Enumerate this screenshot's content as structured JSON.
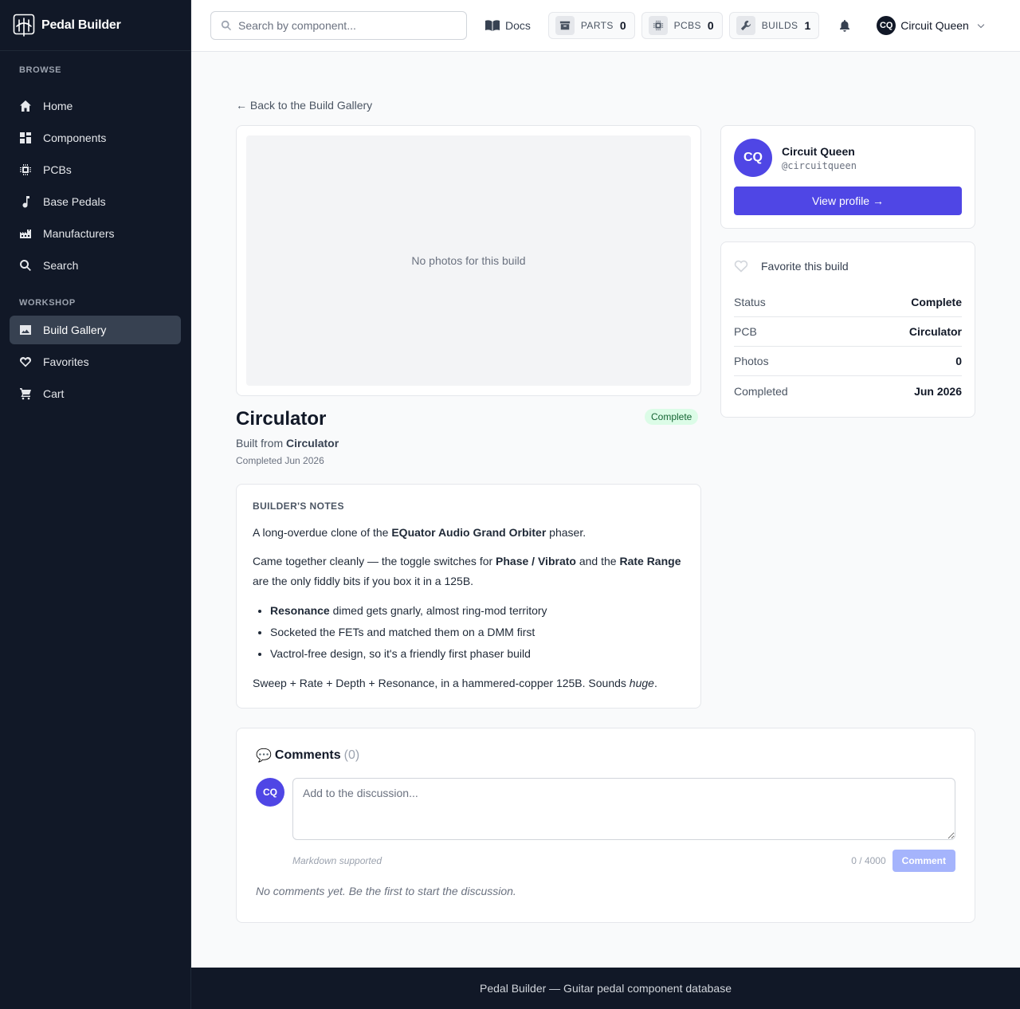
{
  "app": {
    "name": "Pedal Builder"
  },
  "sidebar": {
    "browse_heading": "BROWSE",
    "browse": [
      {
        "label": "Home",
        "icon": "home-icon"
      },
      {
        "label": "Components",
        "icon": "grid-icon"
      },
      {
        "label": "PCBs",
        "icon": "chip-icon"
      },
      {
        "label": "Base Pedals",
        "icon": "music-note-icon"
      },
      {
        "label": "Manufacturers",
        "icon": "factory-icon"
      },
      {
        "label": "Search",
        "icon": "search-icon"
      }
    ],
    "workshop_heading": "WORKSHOP",
    "workshop": [
      {
        "label": "Build Gallery",
        "icon": "image-icon",
        "active": true
      },
      {
        "label": "Favorites",
        "icon": "heart-icon"
      },
      {
        "label": "Cart",
        "icon": "cart-icon"
      }
    ]
  },
  "topbar": {
    "search_placeholder": "Search by component...",
    "docs_label": "Docs",
    "counters": [
      {
        "label": "PARTS",
        "value": "0",
        "icon": "archive-icon"
      },
      {
        "label": "PCBS",
        "value": "0",
        "icon": "chip-icon"
      },
      {
        "label": "BUILDS",
        "value": "1",
        "icon": "wrench-icon"
      }
    ],
    "user": {
      "initials": "CQ",
      "name": "Circuit Queen"
    }
  },
  "build": {
    "back_link": "← Back to the Build Gallery",
    "no_photos": "No photos for this build",
    "title": "Circulator",
    "status_badge": "Complete",
    "built_from_prefix": "Built from",
    "built_from": "Circulator",
    "completed_line": "Completed Jun 2026"
  },
  "notes": {
    "heading": "BUILDER'S NOTES",
    "p1": {
      "pre": "A long-overdue clone of the ",
      "bold": "EQuator Audio Grand Orbiter",
      "post": " phaser."
    },
    "p2": {
      "pre": "Came together cleanly — the toggle switches for ",
      "bold1": "Phase / Vibrato",
      "mid": " and the ",
      "bold2": "Rate Range",
      "post": " are the only fiddly bits if you box it in a 125B."
    },
    "bullets": [
      {
        "bold": "Resonance",
        "text": " dimed gets gnarly, almost ring-mod territory"
      },
      {
        "bold": "",
        "text": "Socketed the FETs and matched them on a DMM first"
      },
      {
        "bold": "",
        "text": "Vactrol-free design, so it's a friendly first phaser build"
      }
    ],
    "p3": {
      "pre": "Sweep + Rate + Depth + Resonance, in a hammered-copper 125B. Sounds ",
      "em": "huge",
      "post": "."
    }
  },
  "profile": {
    "initials": "CQ",
    "name": "Circuit Queen",
    "handle": "@circuitqueen",
    "button": "View profile →"
  },
  "meta": {
    "favorite_label": "Favorite this build",
    "rows": [
      {
        "key": "Status",
        "value": "Complete"
      },
      {
        "key": "PCB",
        "value": "Circulator"
      },
      {
        "key": "Photos",
        "value": "0"
      },
      {
        "key": "Completed",
        "value": "Jun 2026"
      }
    ]
  },
  "comments": {
    "icon": "💬",
    "title": "Comments",
    "count": "(0)",
    "avatar": "CQ",
    "placeholder": "Add to the discussion...",
    "markdown_note": "Markdown supported",
    "char_count": "0 / 4000",
    "button": "Comment",
    "empty": "No comments yet. Be the first to start the discussion."
  },
  "footer": {
    "text": "Pedal Builder — Guitar pedal component database"
  },
  "colors": {
    "accent": "#4f46e5",
    "sidebar_bg": "#111827",
    "badge_bg": "#dcfce7",
    "badge_text": "#166534"
  }
}
